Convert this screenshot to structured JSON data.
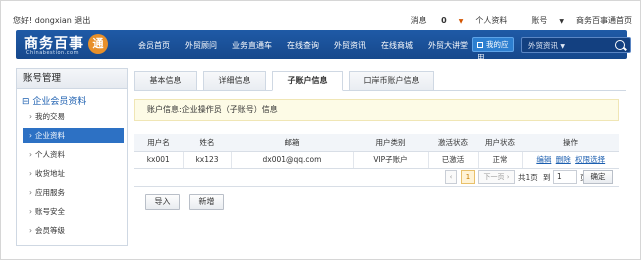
{
  "topbar": {
    "greeting": "您好! dongxian",
    "logout": "退出",
    "messages": "消息",
    "message_count": "0",
    "profile": "个人资料",
    "account": "账号",
    "home": "商务百事通首页"
  },
  "logo": {
    "name": "商务百事",
    "seal": "通",
    "domain": "Chinabestion.com"
  },
  "nav": {
    "items": [
      "会员首页",
      "外贸顾问",
      "业务直通车",
      "在线查询",
      "外贸资讯",
      "在线商城",
      "外贸大讲堂"
    ],
    "my_app": "我的应用",
    "search_label": "外贸资讯"
  },
  "sidebar": {
    "title": "账号管理",
    "group": "企业会员资料",
    "items": [
      "我的交易",
      "企业资料",
      "个人资料",
      "收货地址",
      "应用服务",
      "账号安全",
      "会员等级"
    ],
    "active_index": 1
  },
  "tabs": [
    "基本信息",
    "详细信息",
    "子账户信息",
    "口岸币账户信息"
  ],
  "active_tab": 2,
  "notice": "账户信息:企业操作员（子账号）信息",
  "table": {
    "headers": [
      "用户名",
      "姓名",
      "邮箱",
      "用户类别",
      "激活状态",
      "用户状态",
      "操作"
    ],
    "rows": [
      {
        "username": "kx001",
        "name": "kx123",
        "email": "dx001@qq.com",
        "type": "VIP子账户",
        "activation": "已激活",
        "status": "正常",
        "ops": [
          "编辑",
          "删除",
          "权限选择"
        ]
      }
    ]
  },
  "pager": {
    "prev": "‹",
    "current": "1",
    "next": "下一页",
    "next_arrow": "›",
    "total": "共1页",
    "goto": "到",
    "page_value": "1",
    "page_unit": "页",
    "confirm": "确定"
  },
  "buttons": {
    "import": "导入",
    "add": "新增"
  }
}
